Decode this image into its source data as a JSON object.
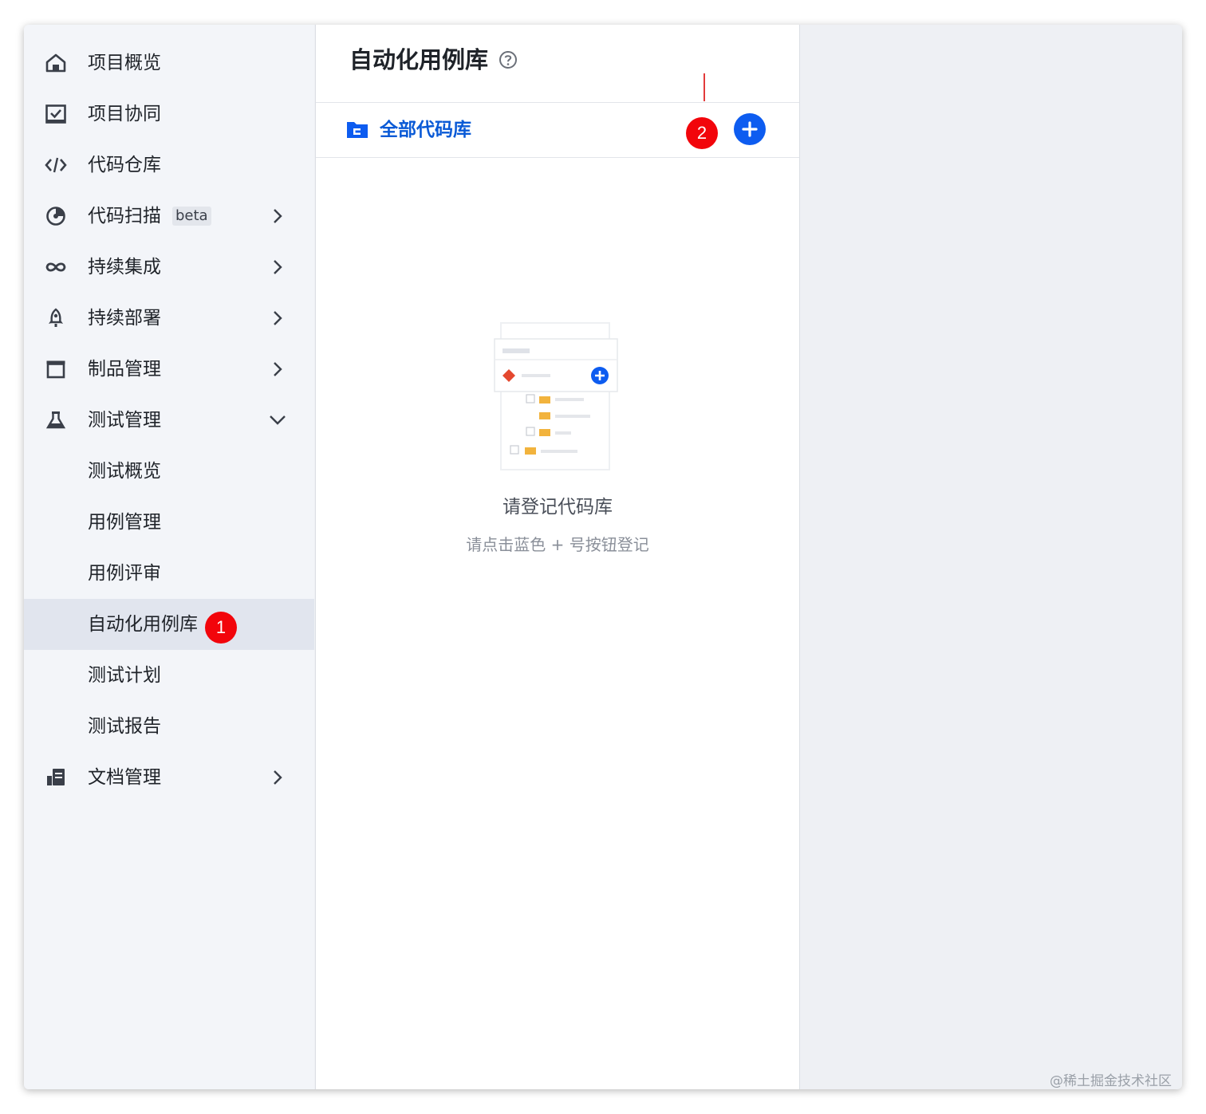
{
  "sidebar": {
    "items": [
      {
        "label": "项目概览",
        "icon": "home-icon"
      },
      {
        "label": "项目协同",
        "icon": "checkbox-board-icon"
      },
      {
        "label": "代码仓库",
        "icon": "code-icon"
      },
      {
        "label": "代码扫描",
        "icon": "scan-icon",
        "badge": "beta"
      },
      {
        "label": "持续集成",
        "icon": "infinity-icon"
      },
      {
        "label": "持续部署",
        "icon": "rocket-icon"
      },
      {
        "label": "制品管理",
        "icon": "package-icon"
      },
      {
        "label": "测试管理",
        "icon": "flask-icon"
      },
      {
        "label": "测试概览"
      },
      {
        "label": "用例管理"
      },
      {
        "label": "用例评审"
      },
      {
        "label": "自动化用例库"
      },
      {
        "label": "测试计划"
      },
      {
        "label": "测试报告"
      },
      {
        "label": "文档管理",
        "icon": "document-icon"
      }
    ],
    "active_item": "自动化用例库"
  },
  "annotations": {
    "marker1": "1",
    "marker2": "2"
  },
  "panel": {
    "title": "自动化用例库",
    "repo_label": "全部代码库",
    "empty_title": "请登记代码库",
    "empty_subtitle": "请点击蓝色 + 号按钮登记"
  },
  "colors": {
    "accent": "#0d5cf0",
    "link": "#0a5ad6",
    "marker": "#f2050b",
    "sidebar_bg": "#f3f5f9",
    "active_bg": "#e1e5ee"
  },
  "watermark": "@稀土掘金技术社区"
}
